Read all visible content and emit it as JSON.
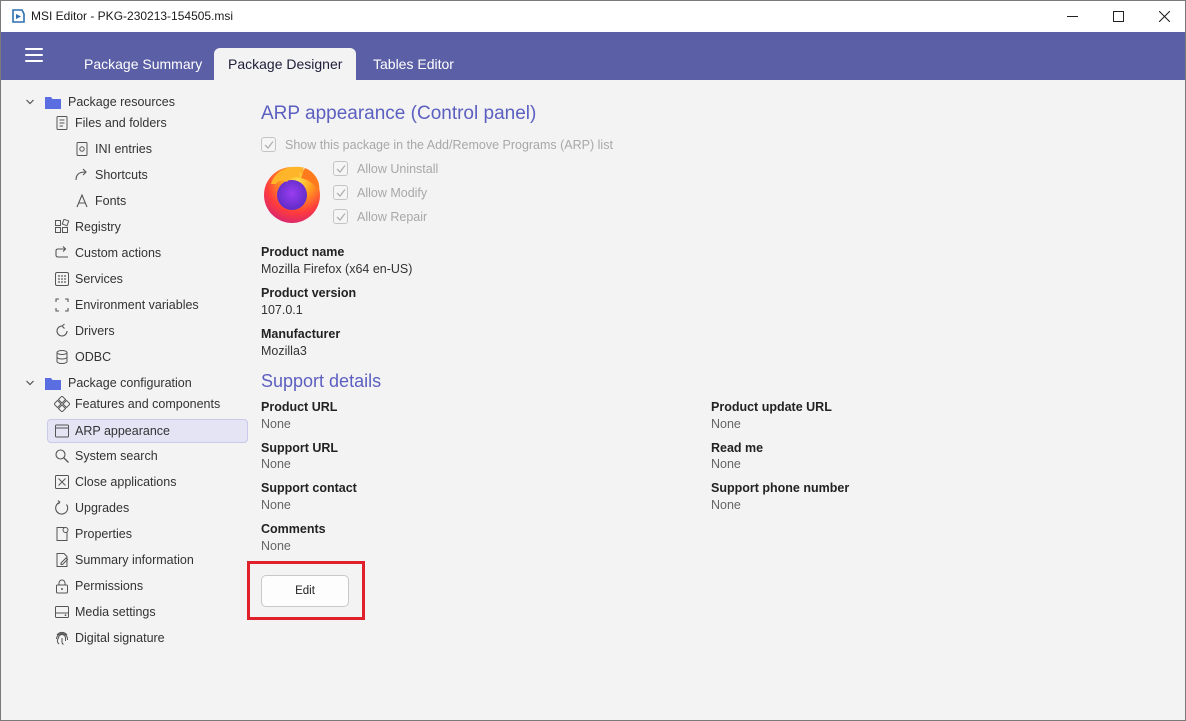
{
  "window": {
    "title": "MSI Editor - PKG-230213-154505.msi",
    "controls": [
      "minimize-icon",
      "maximize-icon",
      "close-icon"
    ]
  },
  "header": {
    "tabs": [
      {
        "label": "Package Summary",
        "active": false
      },
      {
        "label": "Package Designer",
        "active": true
      },
      {
        "label": "Tables Editor",
        "active": false
      }
    ]
  },
  "sidebar": {
    "groups": [
      {
        "label": "Package resources",
        "items": [
          {
            "label": "Files and folders",
            "icon": "file-icon"
          },
          {
            "label": "INI entries",
            "icon": "ini-file-icon"
          },
          {
            "label": "Shortcuts",
            "icon": "shortcut-arrow-icon"
          },
          {
            "label": "Fonts",
            "icon": "font-icon"
          },
          {
            "label": "Registry",
            "icon": "registry-icon"
          },
          {
            "label": "Custom actions",
            "icon": "custom-action-icon"
          },
          {
            "label": "Services",
            "icon": "services-icon"
          },
          {
            "label": "Environment variables",
            "icon": "environment-variables-icon"
          },
          {
            "label": "Drivers",
            "icon": "drivers-icon"
          },
          {
            "label": "ODBC",
            "icon": "database-icon"
          }
        ]
      },
      {
        "label": "Package configuration",
        "items": [
          {
            "label": "Features and components",
            "icon": "features-icon"
          },
          {
            "label": "ARP appearance",
            "icon": "window-icon",
            "selected": true
          },
          {
            "label": "System search",
            "icon": "search-icon"
          },
          {
            "label": "Close applications",
            "icon": "close-app-icon"
          },
          {
            "label": "Upgrades",
            "icon": "upgrade-icon"
          },
          {
            "label": "Properties",
            "icon": "properties-icon"
          },
          {
            "label": "Summary information",
            "icon": "summary-icon"
          },
          {
            "label": "Permissions",
            "icon": "lock-icon"
          },
          {
            "label": "Media settings",
            "icon": "media-icon"
          },
          {
            "label": "Digital signature",
            "icon": "fingerprint-icon"
          }
        ]
      }
    ]
  },
  "main": {
    "title": "ARP appearance (Control panel)",
    "show_in_arp": "Show this package in the Add/Remove Programs (ARP) list",
    "checkboxes": [
      "Allow Uninstall",
      "Allow Modify",
      "Allow Repair"
    ],
    "product_name_label": "Product name",
    "product_name": "Mozilla Firefox (x64 en-US)",
    "product_version_label": "Product version",
    "product_version": "107.0.1",
    "manufacturer_label": "Manufacturer",
    "manufacturer": "Mozilla3",
    "support_title": "Support details",
    "support": {
      "left": [
        {
          "label": "Product URL",
          "value": "None"
        },
        {
          "label": "Support URL",
          "value": "None"
        },
        {
          "label": "Support contact",
          "value": "None"
        },
        {
          "label": "Comments",
          "value": "None"
        }
      ],
      "right": [
        {
          "label": "Product update URL",
          "value": "None"
        },
        {
          "label": "Read me",
          "value": "None"
        },
        {
          "label": "Support phone number",
          "value": "None"
        }
      ]
    },
    "edit_button": "Edit",
    "highlight_color": "#e0202a",
    "accent_color": "#5b5fa5"
  }
}
